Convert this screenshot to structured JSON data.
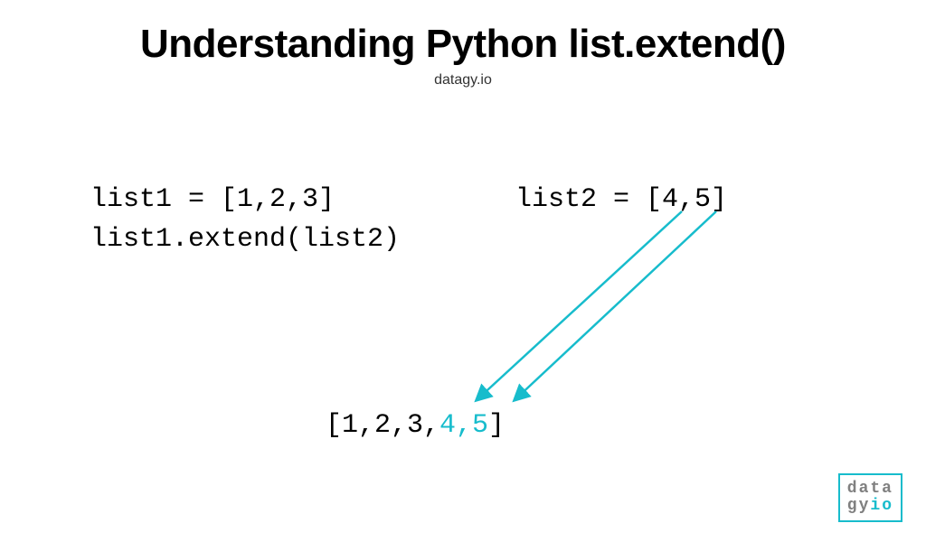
{
  "header": {
    "title": "Understanding Python list.extend()",
    "subtitle": "datagy.io"
  },
  "code": {
    "line1": "list1 = [1,2,3]",
    "line2": "list2 = [4,5]",
    "line3": "list1.extend(list2)"
  },
  "result": {
    "part1": "[1,2,3,",
    "part2": "4,5",
    "part3": "]"
  },
  "logo": {
    "line1": "data",
    "line2a": "gy",
    "line2b": "io"
  },
  "colors": {
    "accent": "#17bccc"
  }
}
